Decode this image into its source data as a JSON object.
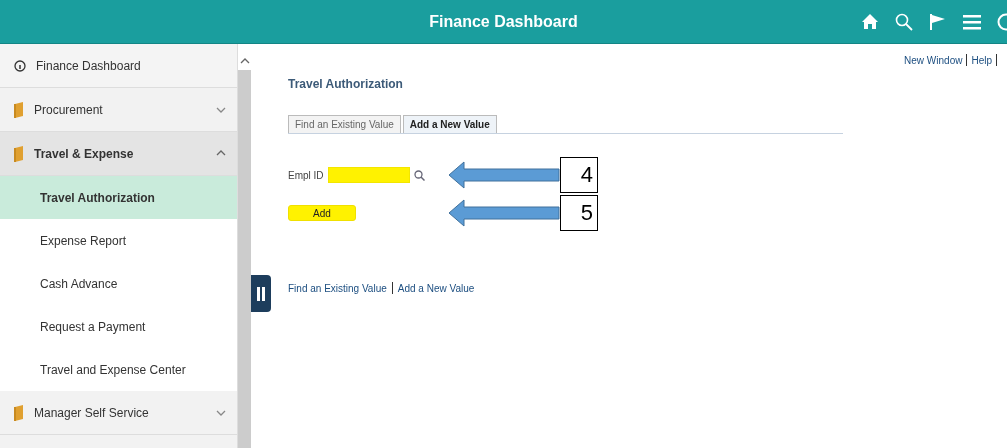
{
  "header": {
    "title": "Finance Dashboard"
  },
  "sidebar": {
    "items": [
      {
        "kind": "dashboard",
        "label": "Finance Dashboard"
      },
      {
        "kind": "folder",
        "label": "Procurement",
        "expanded": false
      },
      {
        "kind": "folder",
        "label": "Travel & Expense",
        "expanded": true,
        "children": [
          {
            "label": "Travel Authorization",
            "selected": true
          },
          {
            "label": "Expense Report",
            "selected": false
          },
          {
            "label": "Cash Advance",
            "selected": false
          },
          {
            "label": "Request a Payment",
            "selected": false
          },
          {
            "label": "Travel and Expense Center",
            "selected": false
          }
        ]
      },
      {
        "kind": "folder",
        "label": "Manager Self Service",
        "expanded": false
      }
    ]
  },
  "top_links": [
    "New Window",
    "Help"
  ],
  "page": {
    "title": "Travel Authorization",
    "tabs": [
      {
        "label": "Find an Existing Value",
        "selected": false
      },
      {
        "label": "Add a New Value",
        "selected": true
      }
    ],
    "empl_id": {
      "label": "Empl ID",
      "highlighted": true
    },
    "add_button": {
      "label": "Add",
      "highlighted": true
    },
    "callouts": [
      "4",
      "5"
    ],
    "bottom_links": [
      "Find an Existing Value",
      "Add a New Value"
    ]
  }
}
